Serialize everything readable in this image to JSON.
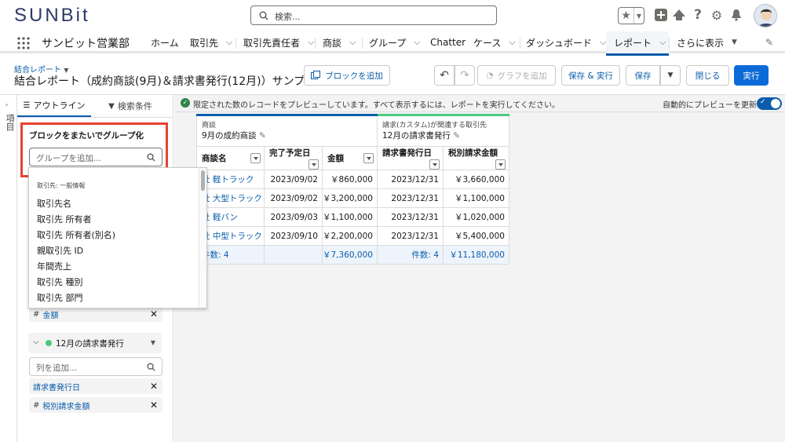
{
  "header": {
    "logo": "SUNBit",
    "search_placeholder": "検索...",
    "icons": [
      "favorites-star-icon",
      "add-icon",
      "trailhead-icon",
      "help-icon",
      "setup-gear-icon",
      "notification-bell-icon"
    ]
  },
  "nav": {
    "app_name": "サンビット営業部",
    "items": [
      {
        "label": "ホーム",
        "chevron": false
      },
      {
        "label": "取引先",
        "chevron": true
      },
      {
        "label": "取引先責任者",
        "chevron": true
      },
      {
        "label": "商談",
        "chevron": true
      },
      {
        "label": "グループ",
        "chevron": true
      },
      {
        "label": "Chatter",
        "chevron": false
      },
      {
        "label": "ケース",
        "chevron": true
      },
      {
        "label": "ダッシュボード",
        "chevron": true
      },
      {
        "label": "レポート",
        "chevron": true,
        "active": true
      },
      {
        "label": "さらに表示",
        "chevron": true
      }
    ]
  },
  "page": {
    "breadcrumb": "結合レポート",
    "title": "結合レポート（成約商談(9月)＆請求書発行(12月)）サンプル",
    "buttons": {
      "add_block": "ブロックを追加",
      "add_chart": "グラフを追加",
      "save_run": "保存 & 実行",
      "save": "保存",
      "close": "閉じる",
      "run": "実行"
    }
  },
  "left": {
    "strip_label": "項目",
    "tab_outline": "アウトライン",
    "tab_filters": "検索条件",
    "group_across": "ブロックをまたいでグループ化",
    "group_placeholder": "グループを追加...",
    "dropdown": {
      "section": "取引先: 一般情報",
      "items": [
        "取引先名",
        "取引先 所有者",
        "取引先 所有者(別名)",
        "親取引先 ID",
        "年間売上",
        "取引先 種別",
        "取引先 部門"
      ]
    },
    "block1_chip": "金額",
    "block2_name": "12月の請求書発行",
    "block2_color": "#4bca81",
    "col_placeholder": "列を追加...",
    "block2_chips": [
      "請求書発行日",
      "税別請求金額"
    ]
  },
  "preview": {
    "info": "限定された数のレコードをプレビューしています。すべて表示するには、レポートを実行してください。",
    "auto_update": "自動的にプレビューを更新",
    "block1": {
      "type": "商談",
      "name": "9月の成約商談",
      "color": "#0b5cab"
    },
    "block2": {
      "type": "請求(カスタム)が関連する取引先",
      "name": "12月の請求書発行",
      "color": "#4bca81"
    },
    "headers": [
      "商談名",
      "完了予定日",
      "金額",
      "請求書発行日",
      "税別請求金額"
    ],
    "rows": [
      [
        "社 軽トラック",
        "2023/09/02",
        "￥860,000",
        "2023/12/31",
        "￥3,660,000"
      ],
      [
        "社 大型トラック",
        "2023/09/02",
        "￥3,200,000",
        "2023/12/31",
        "￥1,100,000"
      ],
      [
        "社 軽バン",
        "2023/09/03",
        "￥1,100,000",
        "2023/12/31",
        "￥1,020,000"
      ],
      [
        "社 中型トラック",
        "2023/09/10",
        "￥2,200,000",
        "2023/12/31",
        "￥5,400,000"
      ]
    ],
    "totals": [
      "件数: 4",
      "",
      "￥7,360,000",
      "件数: 4",
      "￥11,180,000"
    ]
  }
}
